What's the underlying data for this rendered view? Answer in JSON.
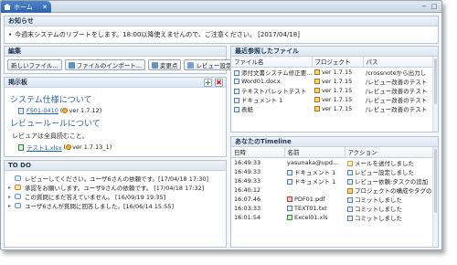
{
  "tab": {
    "title": "ホーム",
    "close": "✕"
  },
  "window_buttons": {
    "minimize": "−",
    "maximize": "□"
  },
  "notice": {
    "title": "お知らせ",
    "text": "今週末システムのリブートをします。18:00以降使えませんので、ご注意ください。 [2017/04/18]"
  },
  "edit": {
    "title": "編集",
    "buttons": [
      {
        "label": "新しいファイル...",
        "icon": "new-file-icon"
      },
      {
        "label": "ファイルのインポート...",
        "icon": "import-icon"
      },
      {
        "label": "変更点",
        "icon": "changes-icon"
      },
      {
        "label": "レビュー設定",
        "icon": "review-settings-icon"
      }
    ]
  },
  "board": {
    "title": "掲示板",
    "add": "+",
    "delete": "✖",
    "topics": [
      {
        "heading": "システム仕様について",
        "file": "FS01-0410",
        "version": "ver 1.7.12)",
        "paren": "("
      },
      {
        "heading": "レビュールールについて",
        "sub": "レビュアは全員読むこと。",
        "file": "テスト1.xlsx",
        "version": "ver 1.7.13_1)",
        "paren": "("
      }
    ]
  },
  "todo": {
    "title": "TO DO",
    "items": [
      {
        "text": "レビューしてください。ユーザ6さんの依頼です。[17/04/18 17:30]",
        "icon": "review-icon"
      },
      {
        "text": "承認をお願いします。ユーザ9さんの依頼です。 [17/04/18 17:32]",
        "icon": "approve-icon"
      },
      {
        "text": "この質問にまだ答えていません。 [16/09/19 19:35]",
        "icon": "question-icon"
      },
      {
        "text": "ユーザ6さんが質問に回答しました。[16/06/14 15:55]",
        "icon": "answer-icon"
      }
    ]
  },
  "recent": {
    "title": "最近参照したファイル",
    "columns": [
      "ファイル名",
      "プロジェクト",
      "パス"
    ],
    "rows": [
      {
        "name": "添付文書システム修正要...",
        "project": "ver 1.7.15",
        "path": "/crossnoteから出力し"
      },
      {
        "name": "Word01.docx",
        "project": "ver 1.7.15",
        "path": "/レビュー改善のテスト"
      },
      {
        "name": "テキストパレットテスト",
        "project": "ver 1.7.15",
        "path": "/レビュー改善のテスト"
      },
      {
        "name": "ドキュメント 1",
        "project": "ver 1.7.15",
        "path": "/レビュー改善のテスト"
      },
      {
        "name": "表紙",
        "project": "ver 1.7.15",
        "path": "/レビュー改善のテスト"
      }
    ]
  },
  "timeline": {
    "title": "あなたのTimeline",
    "columns": [
      "日時",
      "名前",
      "アクション"
    ],
    "rows": [
      {
        "time": "16:49:33",
        "name": "yasunaka@upd...",
        "action": "メールを送付しました"
      },
      {
        "time": "16:49:33",
        "name": "ドキュメント 1",
        "action": "レビュー設定しました"
      },
      {
        "time": "16:49:33",
        "name": "ドキュメント 1",
        "action": "レビュー依頼:タスクの追加"
      },
      {
        "time": "16:40:12",
        "name": "",
        "action": "プロジェクトの構成やタグの"
      },
      {
        "time": "16:07:46",
        "name": "PDF01.pdf",
        "action": "コミットしました"
      },
      {
        "time": "16:03:33",
        "name": "TEXT01.txt",
        "action": "コミットしました"
      },
      {
        "time": "16:01:54",
        "name": "Excel01.xls",
        "action": "コミットしました"
      }
    ]
  }
}
